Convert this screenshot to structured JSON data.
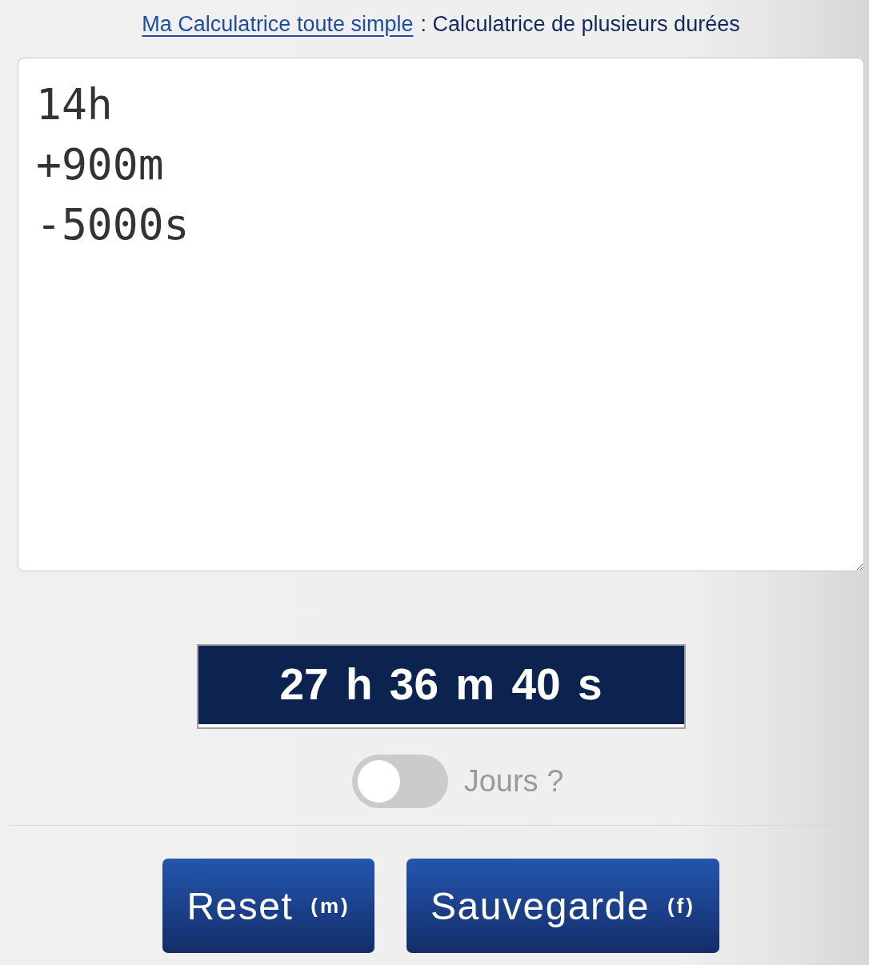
{
  "header": {
    "link": "Ma Calculatrice toute simple",
    "title": ": Calculatrice de plusieurs durées"
  },
  "input": {
    "value": "14h\n+900m\n-5000s"
  },
  "result": "27 h 36 m 40 s",
  "days_toggle": {
    "label": "Jours ?",
    "on": false
  },
  "buttons": [
    {
      "label": "Reset",
      "shortcut": "(m)"
    },
    {
      "label": "Sauvegarde",
      "shortcut": "(f)"
    }
  ]
}
